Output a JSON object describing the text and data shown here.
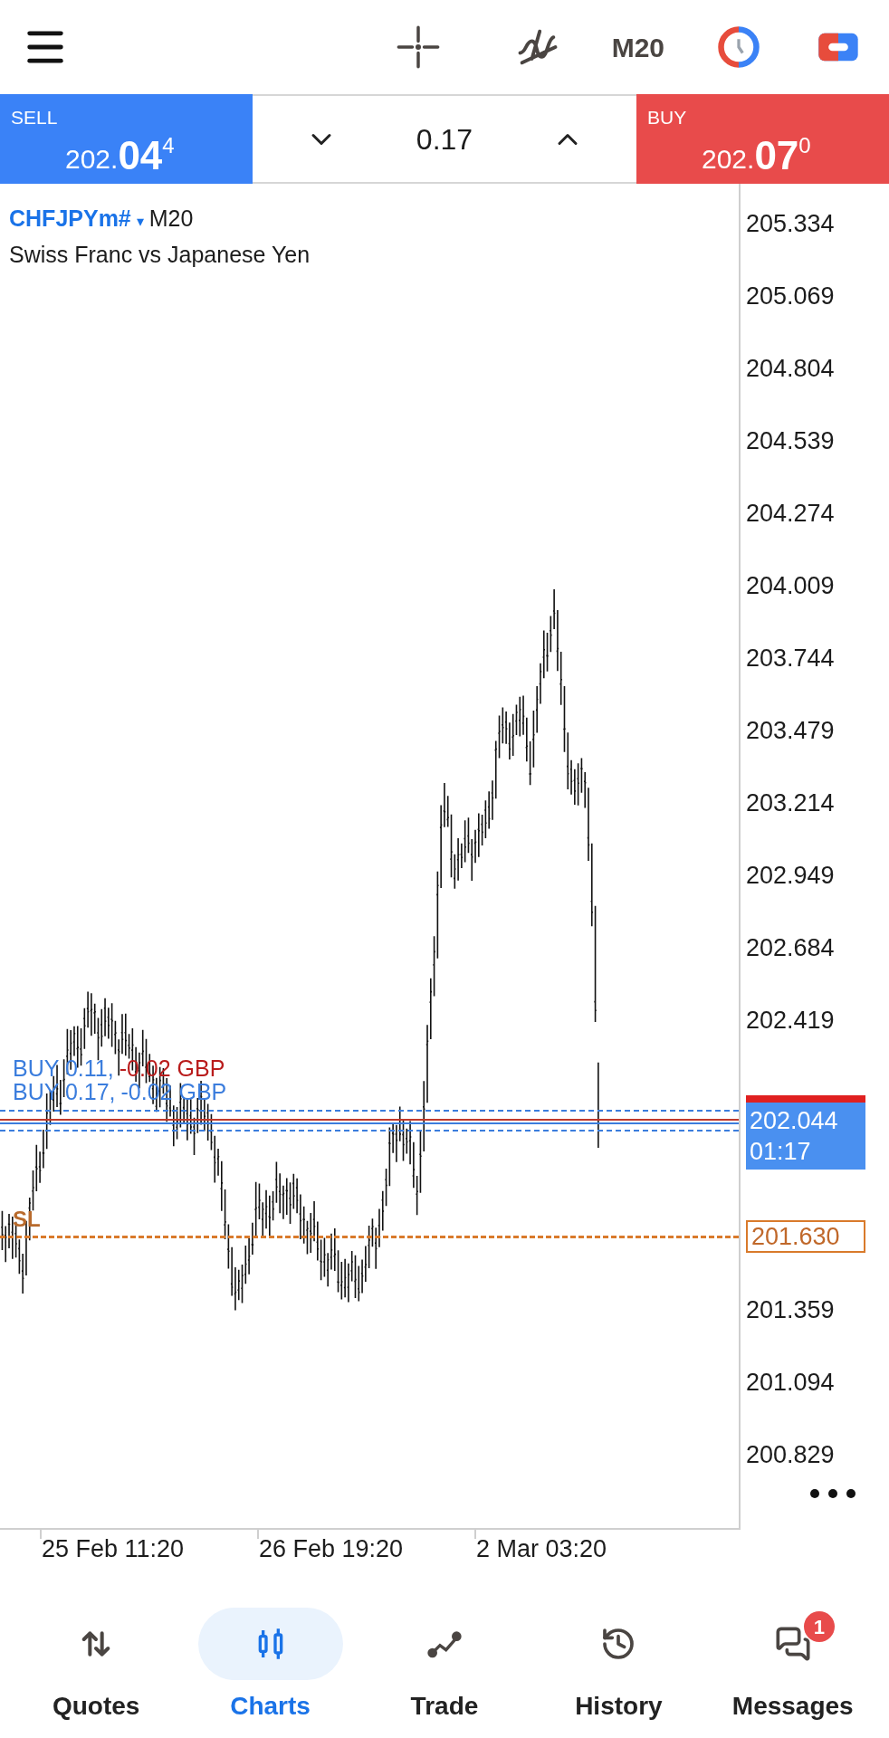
{
  "toolbar": {
    "timeframe": "M20"
  },
  "trade_panel": {
    "sell": {
      "label": "SELL",
      "price": "202.",
      "big": "04",
      "sup": "4"
    },
    "volume": "0.17",
    "buy": {
      "label": "BUY",
      "price": "202.",
      "big": "07",
      "sup": "0"
    }
  },
  "chart": {
    "symbol": "CHFJPYm#",
    "dropdown": "▾",
    "timeframe": "M20",
    "description": "Swiss Franc vs Japanese Yen",
    "price_axis": [
      "205.334",
      "205.069",
      "204.804",
      "204.539",
      "204.274",
      "204.009",
      "203.744",
      "203.479",
      "203.214",
      "202.949",
      "202.684",
      "202.419",
      "201.359",
      "201.094",
      "200.829"
    ],
    "positions": [
      {
        "text": "BUY 0.11,",
        "profit": "-0.02 GBP",
        "color": "#b91c1c"
      },
      {
        "text": "BUY 0.17,",
        "profit": "-0.02 GBP",
        "color": "#3b7ddd"
      }
    ],
    "current_price": {
      "price": "202.044",
      "countdown": "01:17"
    },
    "stop_loss": {
      "label": "SL",
      "price": "201.630"
    },
    "time_axis": [
      "25 Feb 11:20",
      "26 Feb 19:20",
      "2 Mar 03:20"
    ]
  },
  "nav": [
    {
      "kind": "quotes",
      "label": "Quotes",
      "selected": false
    },
    {
      "kind": "charts",
      "label": "Charts",
      "selected": true
    },
    {
      "kind": "trade",
      "label": "Trade",
      "selected": false
    },
    {
      "kind": "history",
      "label": "History",
      "selected": false
    },
    {
      "kind": "messages",
      "label": "Messages",
      "selected": false,
      "badge": "1"
    }
  ]
}
